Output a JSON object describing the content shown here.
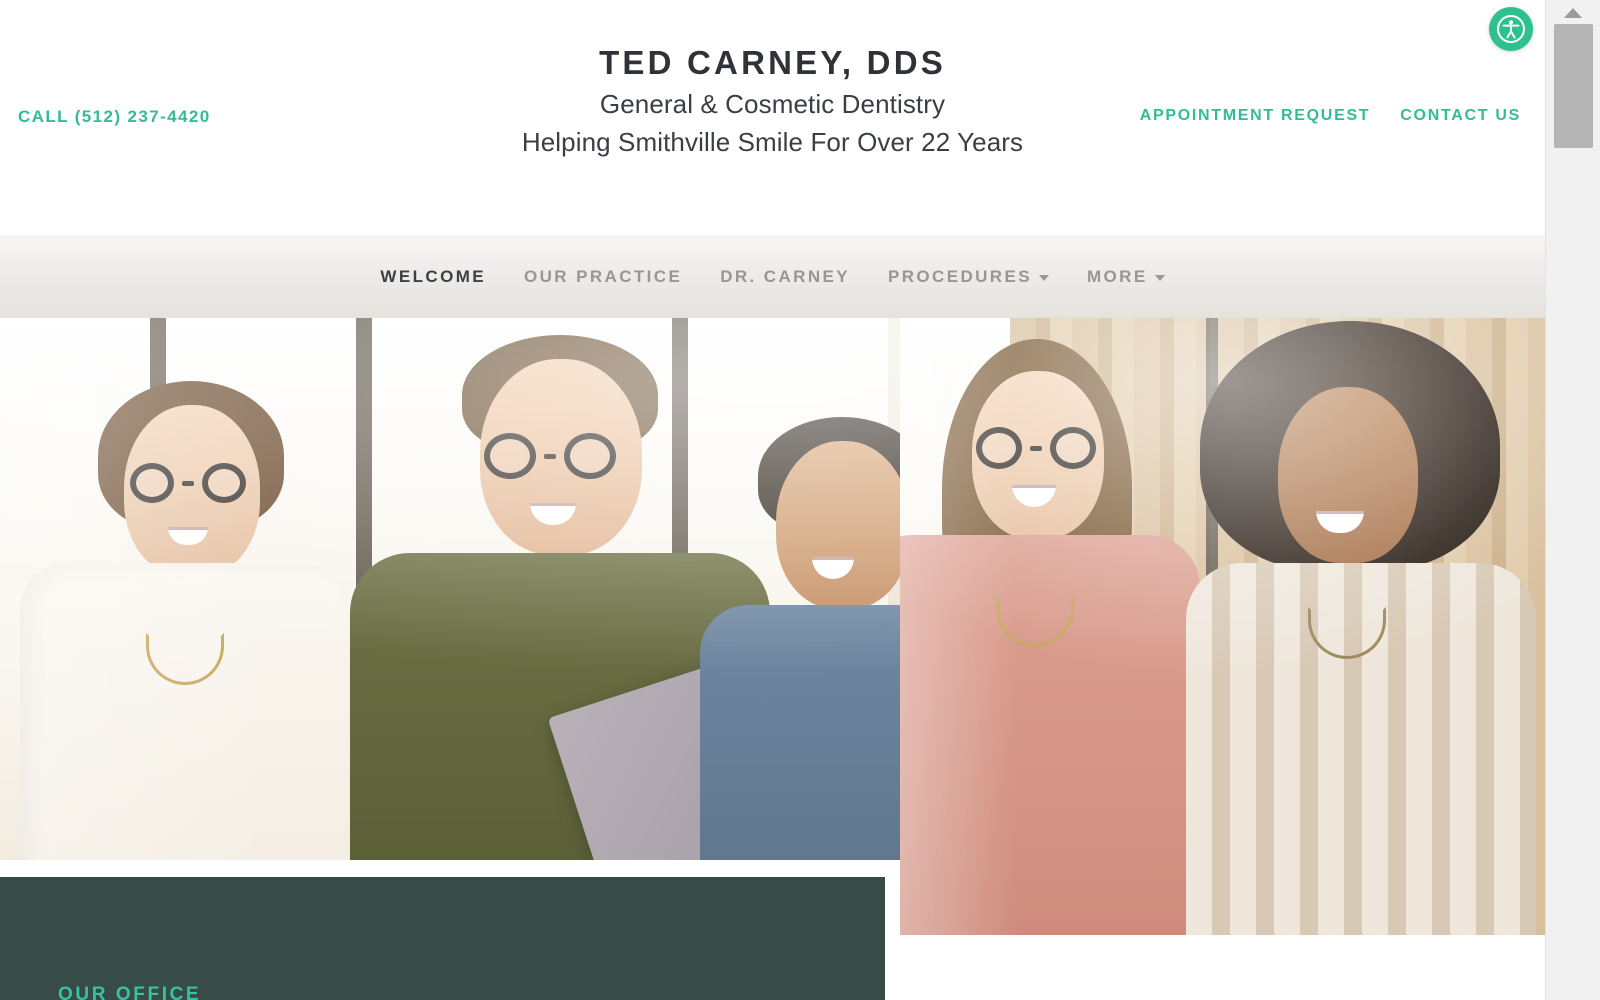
{
  "header": {
    "phone_label": "CALL (512) 237-4420",
    "brand_title": "TED CARNEY, DDS",
    "brand_sub_line1": "General & Cosmetic Dentistry",
    "brand_sub_line2": "Helping Smithville Smile For Over 22 Years",
    "links": [
      {
        "label": "APPOINTMENT REQUEST"
      },
      {
        "label": "CONTACT US"
      }
    ],
    "accessibility_icon": "accessibility-icon"
  },
  "nav": {
    "items": [
      {
        "label": "WELCOME",
        "active": true,
        "has_dropdown": false
      },
      {
        "label": "OUR PRACTICE",
        "active": false,
        "has_dropdown": false
      },
      {
        "label": "DR. CARNEY",
        "active": false,
        "has_dropdown": false
      },
      {
        "label": "PROCEDURES",
        "active": false,
        "has_dropdown": true
      },
      {
        "label": "MORE",
        "active": false,
        "has_dropdown": true
      }
    ]
  },
  "hero": {
    "alt": "five smiling people standing together in a bright office"
  },
  "office_card": {
    "title": "OUR OFFICE"
  },
  "colors": {
    "accent_teal": "#33bc95",
    "accent_teal_bright": "#35c3a0",
    "dark_green": "#374c46",
    "nav_text": "#9a9692",
    "nav_active": "#3d4045",
    "heading": "#2f3338"
  },
  "scrollbar": {
    "up_arrow_icon": "chevron-up-icon"
  }
}
